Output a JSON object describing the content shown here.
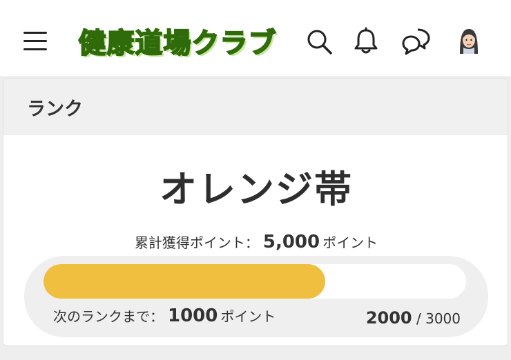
{
  "header": {
    "logo_text": "健康道場クラブ",
    "icons": [
      "menu-icon",
      "search-icon",
      "bell-icon",
      "chat-icon",
      "avatar"
    ],
    "brand_color": "#74c41f"
  },
  "rank_panel": {
    "title": "ランク",
    "rank_name": "オレンジ帯",
    "points_label": "累計獲得ポイント：",
    "points_value": "5,000",
    "points_unit": "ポイント",
    "next_label": "次のランクまで：",
    "next_value": "1000",
    "next_unit": "ポイント",
    "progress_current": "2000",
    "progress_separator": "/",
    "progress_total": "3000",
    "progress_fraction": 0.667,
    "progress_color": "#f0bf40"
  }
}
